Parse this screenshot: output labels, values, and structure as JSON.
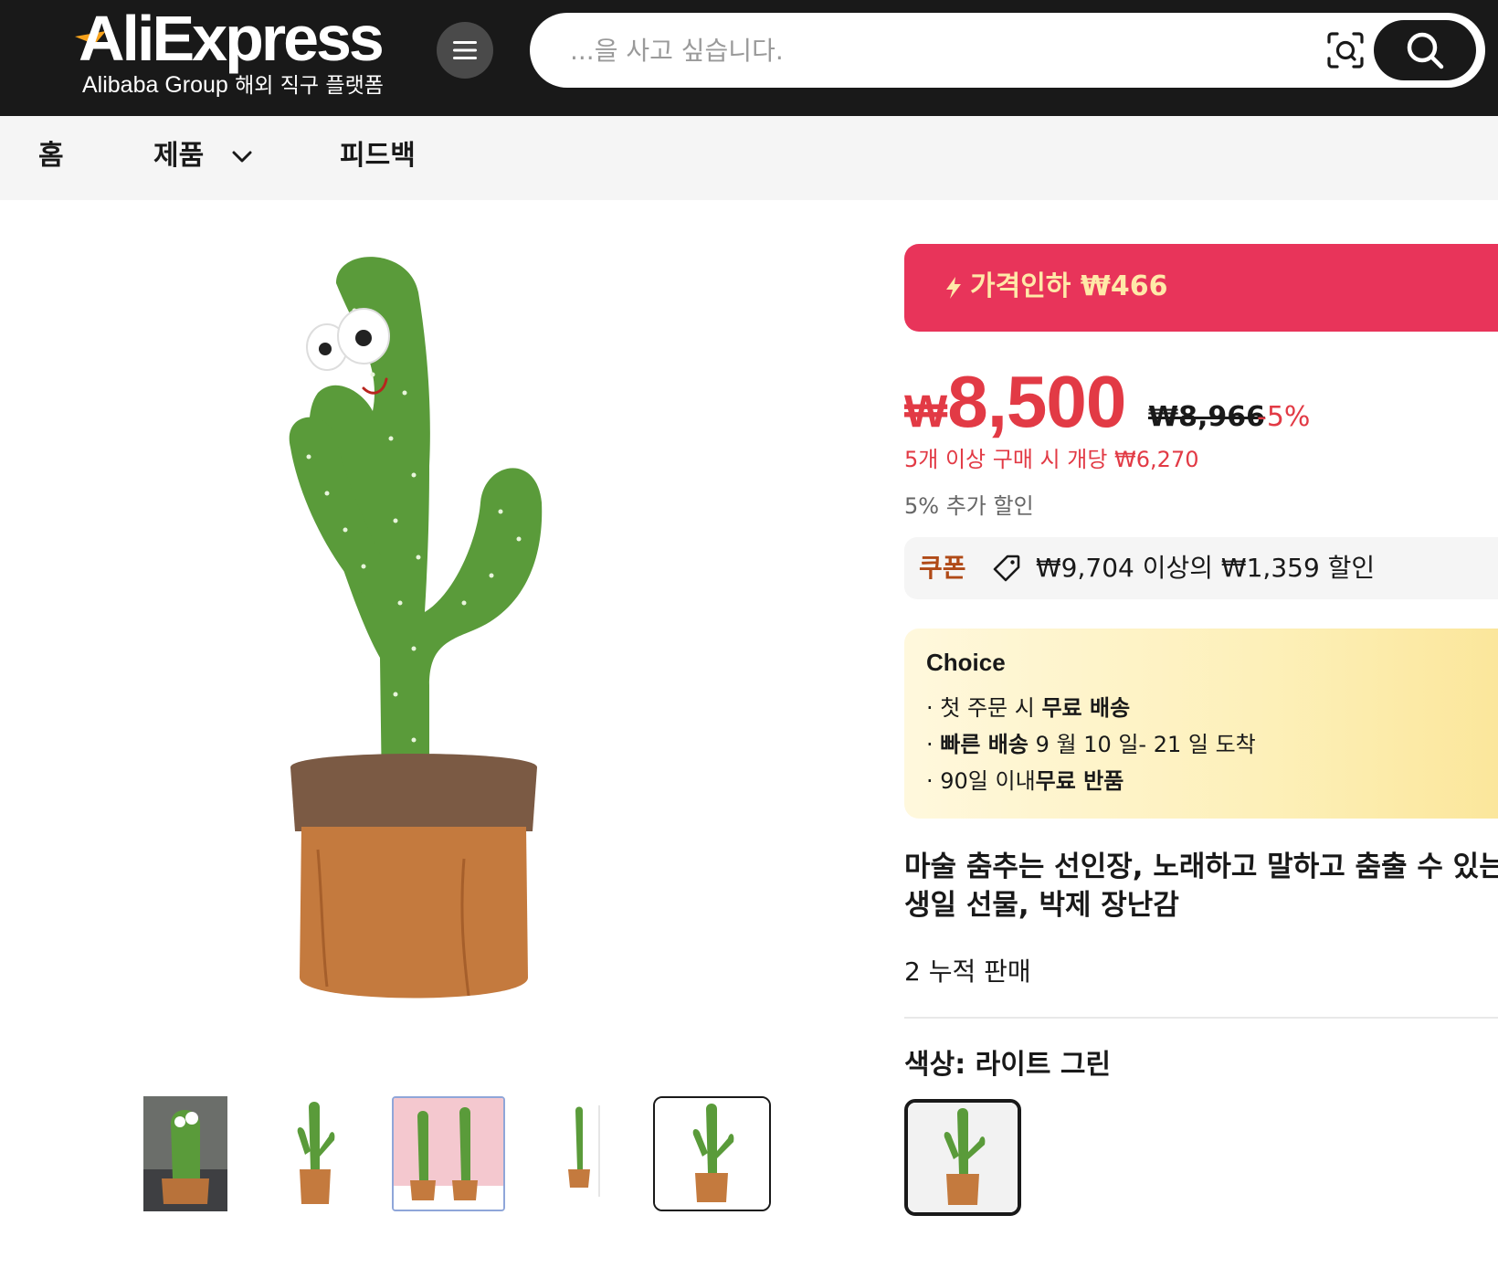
{
  "header": {
    "logo_text": "AliExpress",
    "logo_sub_group": "Alibaba Group",
    "logo_sub_kr": "해외 직구 플랫폼",
    "search_placeholder": "...을 사고 싶습니다.",
    "icons": {
      "menu": "menu-icon",
      "camera": "camera-search-icon",
      "search": "search-icon"
    }
  },
  "nav": {
    "items": [
      "홈",
      "제품",
      "피드백"
    ]
  },
  "product": {
    "banner_text": "가격인하 ₩466",
    "price_currency": "₩",
    "price_value": "8,500",
    "original_price": "₩8,966",
    "discount": "-5%",
    "bulk_price": "5개 이상 구매 시 개당 ₩6,270",
    "extra_discount": "5% 추가 할인",
    "coupon_tag": "쿠폰",
    "coupon_text": "₩9,704 이상의 ₩1,359 할인",
    "choice": {
      "title": "Choice",
      "line1_pre": "· 첫 주문 시 ",
      "line1_bold": "무료 배송",
      "line2_pre": "· ",
      "line2_bold": "빠른 배송",
      "line2_post": " 9 월 10 일- 21 일 도착",
      "line3_pre": "· 90일 이내",
      "line3_bold": "무료 반품"
    },
    "title_line1": "마술 춤추는 선인장, 노래하고 말하고 춤출 수 있는",
    "title_line2": "생일 선물, 박제 장난감",
    "sold": "2 누적 판매",
    "color_label": "색상: 라이트 그린"
  },
  "colors": {
    "header_bg": "#191919",
    "banner_red": "#e8345a",
    "price_red": "#e23a45",
    "banner_text": "#ffe9a8",
    "coupon_brown": "#b04a17",
    "cactus_green": "#5a9b3a",
    "pot_brown": "#c47a3e"
  }
}
